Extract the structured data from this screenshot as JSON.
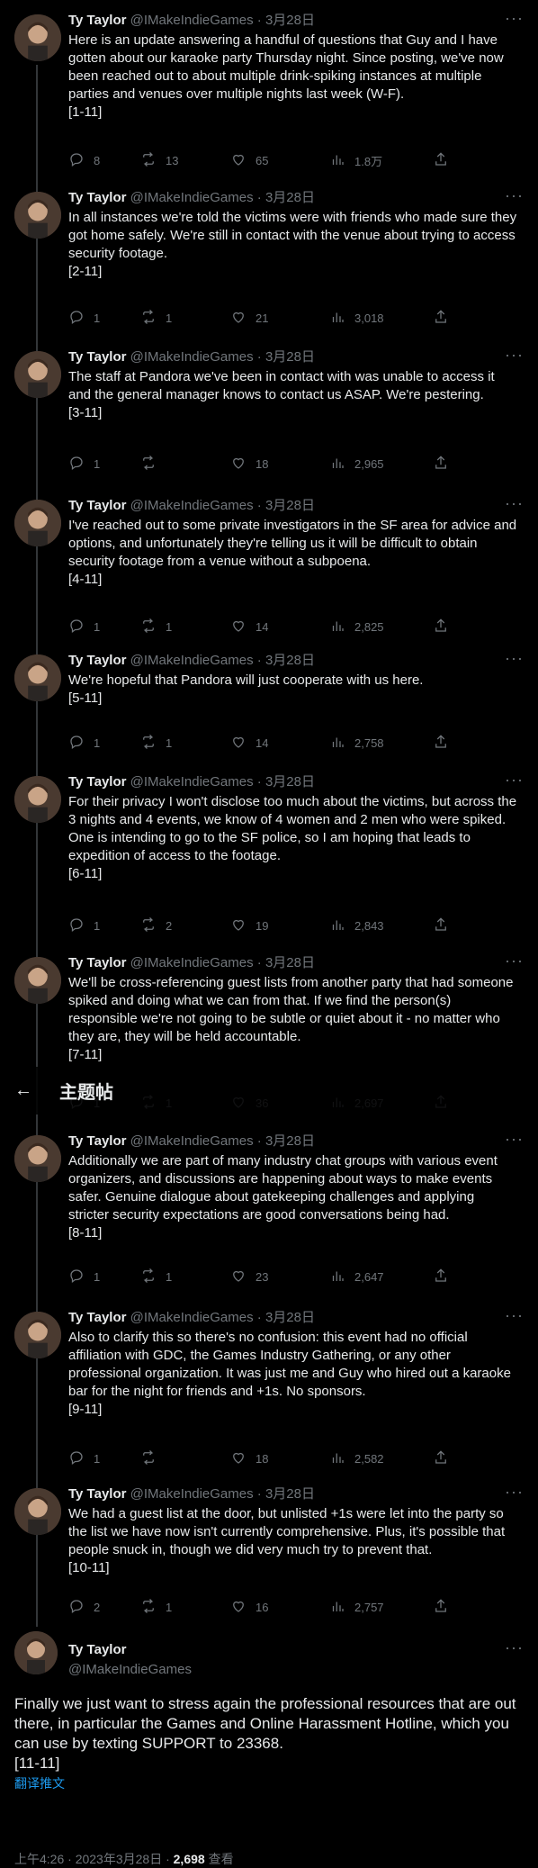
{
  "author": {
    "name": "Ty Taylor",
    "handle": "@IMakeIndieGames",
    "date": "3月28日"
  },
  "tweets": [
    {
      "text": "Here is an update answering a handful of questions that Guy and I have gotten about our karaoke party Thursday night. Since posting, we've now been reached out to about multiple drink-spiking instances at multiple parties and venues over multiple nights last week (W-F).",
      "tag": "[1-11]",
      "reply": "8",
      "retweet": "13",
      "like": "65",
      "views": "1.8万"
    },
    {
      "text": "In all instances we're told the victims were with friends who made sure they got home safely. We're still in contact with the venue about trying to access security footage.",
      "tag": "[2-11]",
      "reply": "1",
      "retweet": "1",
      "like": "21",
      "views": "3,018"
    },
    {
      "text": "The staff at Pandora we've been in contact with was unable to access it and the general manager knows to contact us ASAP. We're pestering.",
      "tag": "[3-11]",
      "reply": "1",
      "retweet": "",
      "like": "18",
      "views": "2,965"
    },
    {
      "text": "I've reached out to some private investigators in the SF area for advice and options, and unfortunately they're telling us it will be difficult to obtain security footage from a venue without a subpoena.",
      "tag": "[4-11]",
      "reply": "1",
      "retweet": "1",
      "like": "14",
      "views": "2,825"
    },
    {
      "text": "We're hopeful that Pandora will just cooperate with us here.",
      "tag": "[5-11]",
      "reply": "1",
      "retweet": "1",
      "like": "14",
      "views": "2,758"
    },
    {
      "text": "For their privacy I won't disclose too much about the victims, but across the 3 nights and 4 events, we know of 4 women and 2 men who were spiked. One is intending to go to the SF police, so I am hoping that leads to expedition of access to the footage.",
      "tag": "[6-11]",
      "reply": "1",
      "retweet": "2",
      "like": "19",
      "views": "2,843"
    },
    {
      "text": "We'll be cross-referencing guest lists from another party that had someone spiked and doing what we can from that. If we find the person(s) responsible we're not going to be subtle or quiet about it - no matter who they are, they will be held accountable.",
      "tag": "[7-11]",
      "reply": "1",
      "retweet": "1",
      "like": "36",
      "views": "2,697"
    },
    {
      "text": "Additionally we are part of many industry chat groups with various event organizers, and discussions are happening about ways to make events safer. Genuine dialogue about gatekeeping challenges and applying stricter security expectations are good conversations being had.",
      "tag": "[8-11]",
      "reply": "1",
      "retweet": "1",
      "like": "23",
      "views": "2,647"
    },
    {
      "text": "Also to clarify this so there's no confusion: this event had no official affiliation with GDC, the Games Industry Gathering, or any other professional organization. It was just me and Guy who hired out a karaoke bar for the night for friends and +1s. No sponsors.",
      "tag": "[9-11]",
      "reply": "1",
      "retweet": "",
      "like": "18",
      "views": "2,582"
    },
    {
      "text": "We had a guest list at the door, but unlisted +1s were let into the party so the list we have now isn't currently comprehensive. Plus, it's possible that people snuck in, though we did very much try to prevent that.",
      "tag": "[10-11]",
      "reply": "2",
      "retweet": "1",
      "like": "16",
      "views": "2,757"
    }
  ],
  "header": {
    "title": "主题帖"
  },
  "final": {
    "name": "Ty Taylor",
    "handle": "@IMakeIndieGames",
    "text": "Finally we just want to stress again the professional resources that are out there, in particular the Games and Online Harassment Hotline, which you can use by texting SUPPORT to 23368.",
    "tag": "[11-11]",
    "translate": "翻译推文",
    "time": "上午4:26 · 2023年3月28日 · ",
    "views": "2,698",
    "views_label": " 查看"
  },
  "colors": {
    "background": "#000000",
    "text": "#e7e9ea",
    "muted": "#71767b",
    "link": "#1d9bf0"
  }
}
